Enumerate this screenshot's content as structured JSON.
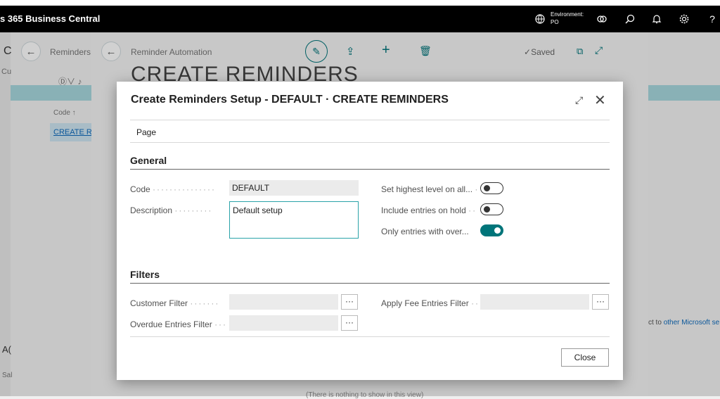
{
  "topbar": {
    "app_title": "s 365 Business Central",
    "env_label": "Environment:",
    "env_value": "PO",
    "icons": [
      "globe-icon",
      "copilot-icon",
      "search-icon",
      "bell-icon",
      "gear-icon",
      "help-icon"
    ]
  },
  "background": {
    "page1_initial": "C",
    "page1_sub": "Cu",
    "page1_breadcrumb": "Reminders A",
    "code_header": "Code ↑",
    "code_value": "CREATE RE",
    "left_bottom_a": "A(",
    "left_bottom_b": "Sal",
    "right_text_prefix": "ct to ",
    "right_text_link": "other Microsoft se",
    "empty_text": "(There is nothing to show in this view)"
  },
  "page2": {
    "breadcrumb": "Reminder Automation",
    "saved_label": "Saved",
    "big_title": "CREATE REMINDERS"
  },
  "modal": {
    "title": "Create Reminders Setup - DEFAULT · CREATE REMINDERS",
    "page_tab": "Page",
    "general_header": "General",
    "filters_header": "Filters",
    "close_label": "Close",
    "fields": {
      "code_label": "Code",
      "code_value": "DEFAULT",
      "description_label": "Description",
      "description_value": "Default setup",
      "set_highest_label": "Set highest level on all...",
      "include_hold_label": "Include entries on hold",
      "only_overdue_label": "Only entries with over...",
      "customer_filter_label": "Customer Filter",
      "overdue_filter_label": "Overdue Entries Filter",
      "apply_fee_label": "Apply Fee Entries Filter"
    },
    "toggles": {
      "set_highest": false,
      "include_hold": false,
      "only_overdue": true
    },
    "colors": {
      "accent": "#00757a",
      "focus_border": "#2aa3a8"
    }
  }
}
